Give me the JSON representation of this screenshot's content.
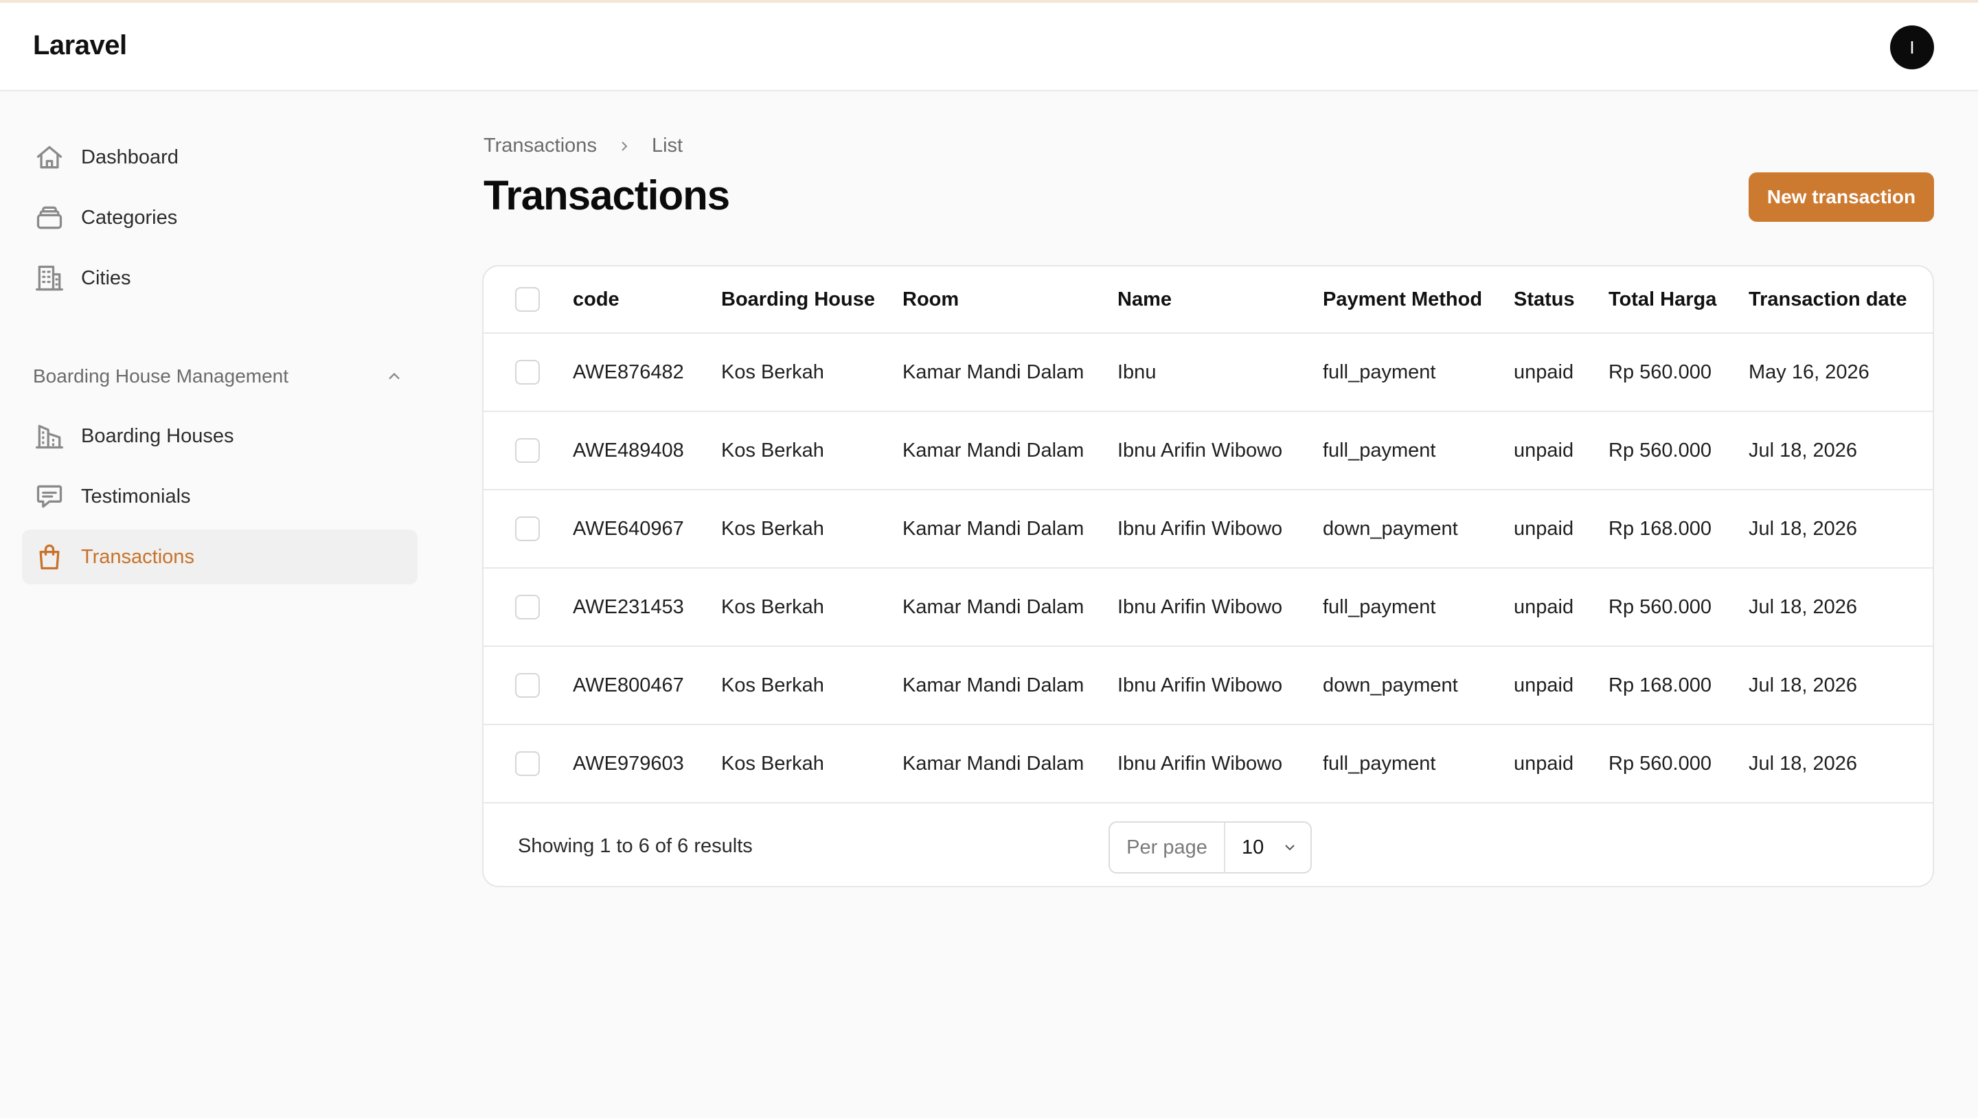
{
  "app": {
    "brand": "Laravel",
    "user_initial": "I"
  },
  "sidebar": {
    "items": [
      {
        "label": "Dashboard",
        "icon": "home-icon"
      },
      {
        "label": "Categories",
        "icon": "stack-icon"
      },
      {
        "label": "Cities",
        "icon": "building-icon"
      }
    ],
    "group": {
      "label": "Boarding House Management",
      "items": [
        {
          "label": "Boarding Houses",
          "icon": "building-office-icon"
        },
        {
          "label": "Testimonials",
          "icon": "chat-icon"
        },
        {
          "label": "Transactions",
          "icon": "shopping-bag-icon",
          "active": true
        }
      ]
    }
  },
  "breadcrumb": {
    "root": "Transactions",
    "current": "List"
  },
  "page": {
    "title": "Transactions",
    "new_button": "New transaction"
  },
  "table": {
    "columns": [
      "code",
      "Boarding House",
      "Room",
      "Name",
      "Payment Method",
      "Status",
      "Total Harga",
      "Transaction date"
    ],
    "rows": [
      {
        "code": "AWE876482",
        "boarding_house": "Kos Berkah",
        "room": "Kamar Mandi Dalam",
        "name": "Ibnu",
        "payment_method": "full_payment",
        "status": "unpaid",
        "total": "Rp 560.000",
        "date": "May 16, 2026"
      },
      {
        "code": "AWE489408",
        "boarding_house": "Kos Berkah",
        "room": "Kamar Mandi Dalam",
        "name": "Ibnu Arifin Wibowo",
        "payment_method": "full_payment",
        "status": "unpaid",
        "total": "Rp 560.000",
        "date": "Jul 18, 2026"
      },
      {
        "code": "AWE640967",
        "boarding_house": "Kos Berkah",
        "room": "Kamar Mandi Dalam",
        "name": "Ibnu Arifin Wibowo",
        "payment_method": "down_payment",
        "status": "unpaid",
        "total": "Rp 168.000",
        "date": "Jul 18, 2026"
      },
      {
        "code": "AWE231453",
        "boarding_house": "Kos Berkah",
        "room": "Kamar Mandi Dalam",
        "name": "Ibnu Arifin Wibowo",
        "payment_method": "full_payment",
        "status": "unpaid",
        "total": "Rp 560.000",
        "date": "Jul 18, 2026"
      },
      {
        "code": "AWE800467",
        "boarding_house": "Kos Berkah",
        "room": "Kamar Mandi Dalam",
        "name": "Ibnu Arifin Wibowo",
        "payment_method": "down_payment",
        "status": "unpaid",
        "total": "Rp 168.000",
        "date": "Jul 18, 2026"
      },
      {
        "code": "AWE979603",
        "boarding_house": "Kos Berkah",
        "room": "Kamar Mandi Dalam",
        "name": "Ibnu Arifin Wibowo",
        "payment_method": "full_payment",
        "status": "unpaid",
        "total": "Rp 560.000",
        "date": "Jul 18, 2026"
      }
    ]
  },
  "pagination": {
    "summary": "Showing 1 to 6 of 6 results",
    "per_page_label": "Per page",
    "per_page_value": "10"
  },
  "colors": {
    "accent": "#cd7a31",
    "active_text": "#c8722a",
    "background": "#fafafa"
  }
}
